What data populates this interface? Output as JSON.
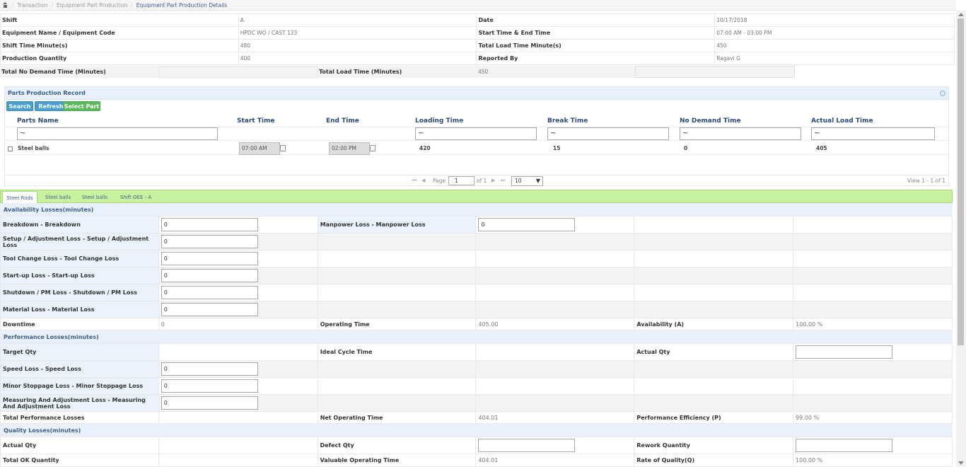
{
  "breadcrumb": {
    "items": [
      "Transaction",
      "Equipment Part Production",
      "Equipment Part Production Details"
    ]
  },
  "info": {
    "shift_label": "Shift",
    "shift_value": "A",
    "date_label": "Date",
    "date_value": "10/17/2018",
    "equipment_label": "Equipment Name / Equipment Code",
    "equipment_value": "HPDC WO / CAST 123",
    "start_end_label": "Start Time & End Time",
    "start_end_value": "07:00 AM - 03:00 PM",
    "shift_time_label": "Shift Time Minute(s)",
    "shift_time_value": "480",
    "total_load_label": "Total Load Time Minute(s)",
    "total_load_value": "450",
    "prod_qty_label": "Production Quantity",
    "prod_qty_value": "400",
    "reported_by_label": "Reported By",
    "reported_by_value": "Ragavi G",
    "no_demand_label": "Total No Demand Time (Minutes)",
    "no_demand_value": "",
    "total_load2_label": "Total Load Time (Minutes)",
    "total_load2_value": "450"
  },
  "grid": {
    "title": "Parts Production Record",
    "buttons": {
      "search": "Search",
      "refresh": "Refresh",
      "select_part": "Select Part"
    },
    "columns": [
      "Parts Name",
      "Start Time",
      "End Time",
      "Loading Time",
      "Break Time",
      "No Demand Time",
      "Actual Load Time"
    ],
    "filter_value": "~",
    "rows": [
      {
        "part": "Steel balls",
        "start": "07:00 AM",
        "end": "02:00 PM",
        "loading": "420",
        "break": "15",
        "no_demand": "0",
        "actual_load": "405"
      }
    ],
    "pager": {
      "page_label": "Page",
      "page": "1",
      "of_label": "of 1",
      "page_size": "10",
      "view": "View 1 - 1 of 1"
    }
  },
  "tabs": [
    "Steel Rods",
    "Steel balls",
    "Steel balls",
    "Shift OEE - A"
  ],
  "availability": {
    "title": "Availability Losses(minutes)",
    "breakdown_label": "Breakdown - Breakdown",
    "breakdown_value": "0",
    "manpower_label": "Manpower Loss - Manpower Loss",
    "manpower_value": "0",
    "setup_label": "Setup / Adjustment Loss - Setup / Adjustment Loss",
    "setup_value": "0",
    "toolchange_label": "Tool Change Loss - Tool Change Loss",
    "toolchange_value": "0",
    "startup_label": "Start-up Loss - Start-up Loss",
    "startup_value": "0",
    "shutdown_label": "Shutdown / PM Loss - Shutdown / PM Loss",
    "shutdown_value": "0",
    "material_label": "Material Loss - Material Loss",
    "material_value": "0",
    "downtime_label": "Downtime",
    "downtime_value": "0",
    "operating_label": "Operating Time",
    "operating_value": "405.00",
    "availability_label": "Availability (A)",
    "availability_value": "100.00 %"
  },
  "performance": {
    "title": "Performance Losses(minutes)",
    "target_label": "Target Qty",
    "target_value": "",
    "ideal_label": "Ideal Cycle Time",
    "ideal_value": "",
    "actual_label": "Actual Qty",
    "actual_value": "",
    "speed_label": "Speed Loss - Speed Loss",
    "speed_value": "0",
    "minor_label": "Minor Stoppage Loss - Minor Stoppage Loss",
    "minor_value": "0",
    "measuring_label": "Measuring And Adjustment Loss - Measuring And Adjustment Loss",
    "measuring_value": "0",
    "total_perf_label": "Total Performance Losses",
    "total_perf_value": "",
    "net_op_label": "Net Operating Time",
    "net_op_value": "404.01",
    "perf_eff_label": "Performance Efficiency (P)",
    "perf_eff_value": "99.00 %"
  },
  "quality": {
    "title": "Quality Losses(minutes)",
    "actual_label": "Actual Qty",
    "actual_value": "",
    "defect_label": "Defect Qty",
    "defect_value": "",
    "rework_label": "Rework Quantity",
    "rework_value": "",
    "total_ok_label": "Total OK Quantity",
    "total_ok_value": "",
    "valuable_label": "Valuable Operating Time",
    "valuable_value": "404.01",
    "rate_label": "Rate of Quality(Q)",
    "rate_value": "100.00 %"
  }
}
